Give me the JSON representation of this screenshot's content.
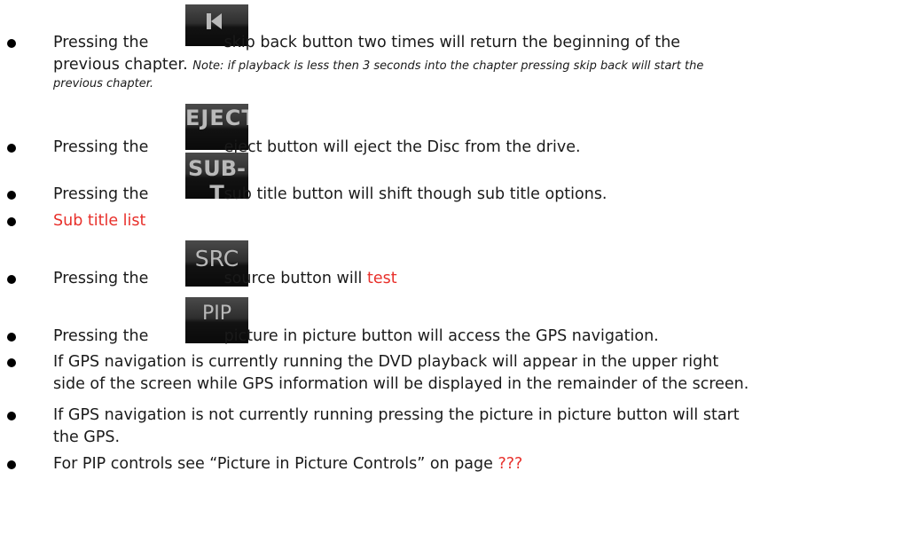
{
  "colors": {
    "red": "#e8302b",
    "button_bg": "#1a1a1a",
    "button_text": "#b9b9b9"
  },
  "items": [
    {
      "before": "Pressing the",
      "button_icon": "skip-back-icon",
      "after": "skip back button two times will return the beginning of the",
      "cont_normal": "previous chapter. ",
      "cont_note": "Note: if playback is less then 3 seconds into the chapter pressing skip back will start the",
      "cont_note2": "previous chapter."
    },
    {
      "before": "Pressing the",
      "button_label": "EJECT",
      "after": "eject button will eject the Disc from the drive."
    },
    {
      "before": "Pressing the",
      "button_label": "SUB-T",
      "after": "sub title button will shift though sub title options."
    },
    {
      "text": "Sub title list"
    },
    {
      "before": "Pressing the",
      "button_label": "SRC",
      "after": "source button will ",
      "after_red": "test"
    },
    {
      "before": "Pressing the",
      "button_label": "PIP",
      "after": "picture in picture button will access the GPS navigation."
    },
    {
      "text": "If GPS navigation is currently running the DVD playback will appear in the upper right",
      "cont": "side of the screen while GPS information will be displayed in the remainder of the screen."
    },
    {
      "text": "If GPS navigation is not currently running pressing the picture in picture button will start",
      "cont": "the GPS."
    },
    {
      "text": "For PIP controls see “Picture in Picture Controls” on page ",
      "text_red": "???"
    }
  ]
}
